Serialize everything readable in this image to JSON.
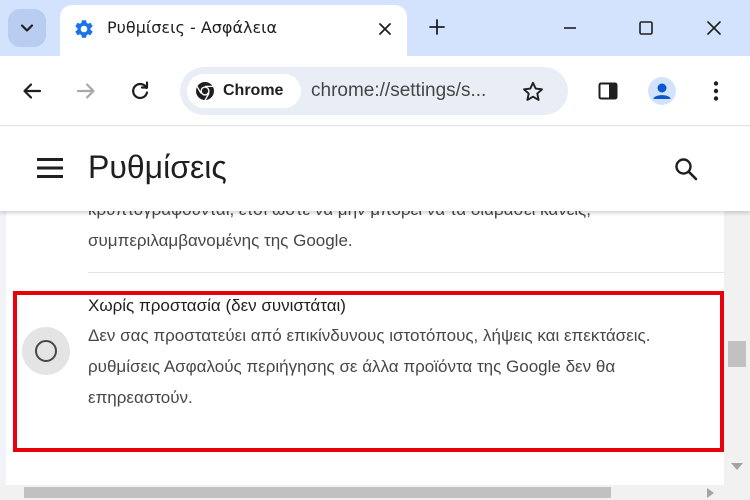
{
  "colors": {
    "tabstrip_bg": "#d3e3fd",
    "accent": "#1a73e8",
    "highlight_border": "#e8000b",
    "content_bg": "#f1f3f8"
  },
  "tab": {
    "title": "Ρυθμίσεις - Ασφάλεια",
    "favicon": "gear-icon"
  },
  "toolbar": {
    "chip_label": "Chrome",
    "url": "chrome://settings/s..."
  },
  "header": {
    "title": "Ρυθμίσεις"
  },
  "content": {
    "previous_option_lines": [
      "κρυπτογραφούνται, έτσι ώστε να μην μπορεί να τα διαβάσει κανείς,",
      "συμπεριλαμβανομένης της Google."
    ],
    "option": {
      "title": "Χωρίς προστασία (δεν συνιστάται)",
      "description_lines": [
        "Δεν σας προστατεύει από επικίνδυνους ιστοτόπους, λήψεις και επεκτάσεις.",
        "ρυθμίσεις Ασφαλούς περιήγησης σε άλλα προϊόντα της Google δεν θα",
        "επηρεαστούν."
      ],
      "selected": false
    }
  }
}
